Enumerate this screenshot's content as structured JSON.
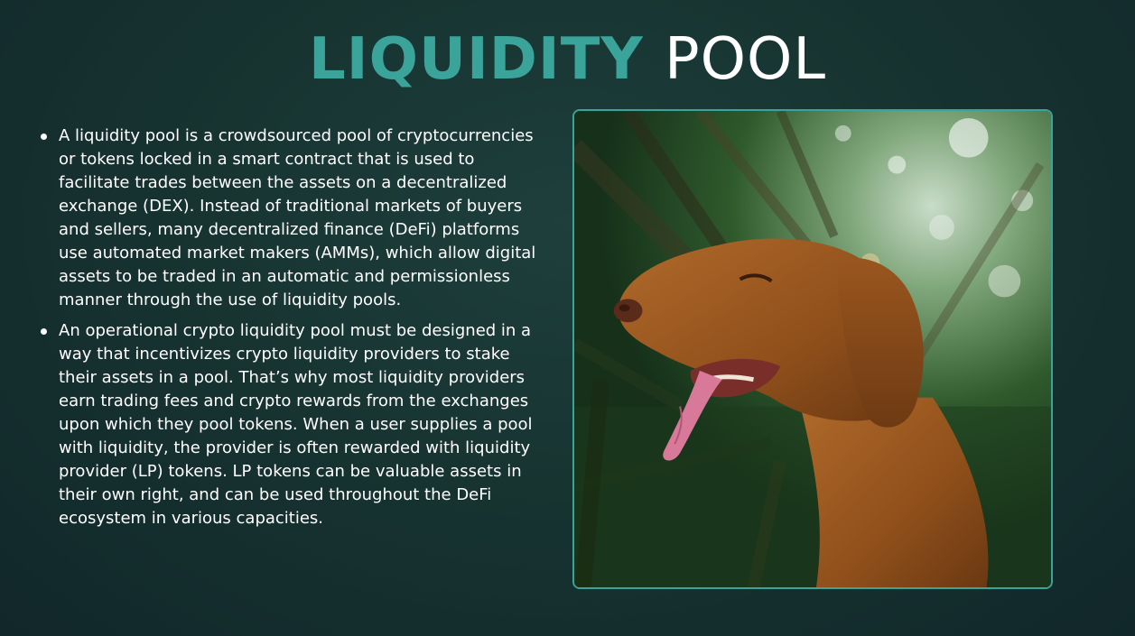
{
  "slide": {
    "title_accent": "LIQUIDITY",
    "title_rest": "POOL",
    "bullets": [
      "A liquidity pool is a crowdsourced pool of cryptocurrencies or tokens locked in a smart contract that is used to facilitate trades between the assets on a decentralized exchange (DEX). Instead of traditional markets of buyers and sellers, many decentralized finance (DeFi) platforms use automated market makers (AMMs), which allow digital assets to be traded in an automatic and permissionless manner through the use of liquidity pools.",
      "An operational crypto liquidity pool must be designed in a way that incentivizes crypto liquidity providers to stake their assets in a pool. That’s why most liquidity providers earn trading fees and crypto rewards from the exchanges upon which they pool tokens. When a user supplies a pool with liquidity, the provider is often rewarded with liquidity provider (LP) tokens. LP tokens can be valuable assets in their own right, and can be used throughout the DeFi ecosystem in various capacities."
    ]
  },
  "colors": {
    "accent": "#3aa39a",
    "background": "#173431",
    "text": "#ffffff"
  }
}
